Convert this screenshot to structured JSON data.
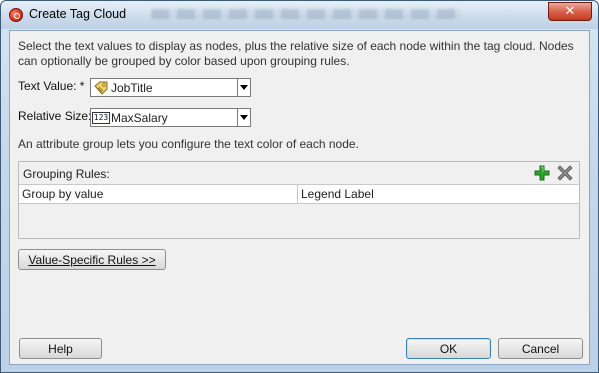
{
  "window": {
    "title": "Create Tag Cloud",
    "close_glyph": "✕"
  },
  "description": "Select the text values to display as nodes, plus the relative size of each node within the tag cloud. Nodes can optionally be grouped by color based upon grouping rules.",
  "text_value": {
    "label": "Text Value: *",
    "value": "JobTitle",
    "icon": "text-tag-icon"
  },
  "relative_size": {
    "label": "Relative Size:",
    "value": "MaxSalary",
    "icon": "numeric-123-icon",
    "icon_text": "123"
  },
  "attribute_note": "An attribute group lets you configure the text color of each node.",
  "grouping_rules": {
    "title": "Grouping Rules:",
    "columns": [
      "Group by value",
      "Legend Label"
    ],
    "rows": []
  },
  "buttons": {
    "value_specific_rules": "Value-Specific Rules >>",
    "help": "Help",
    "ok": "OK",
    "cancel": "Cancel"
  },
  "colors": {
    "add": "#2da32d",
    "remove": "#7a7a7a",
    "accent": "#3c7fb1"
  }
}
